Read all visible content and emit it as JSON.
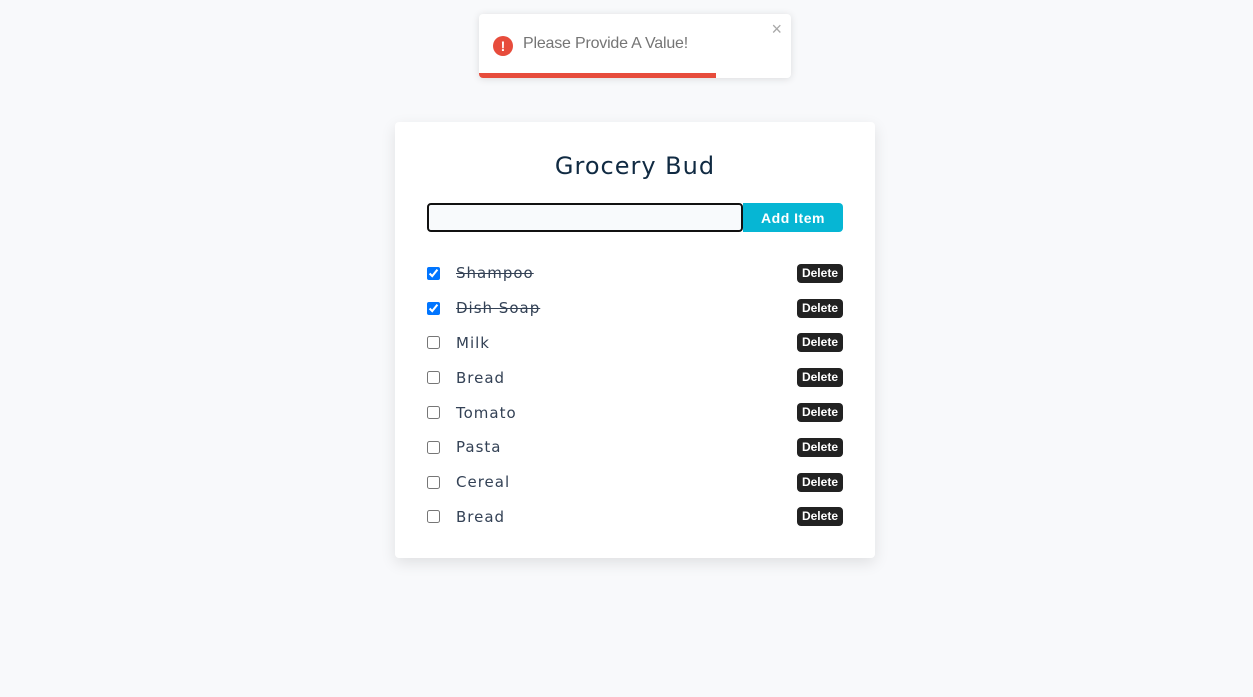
{
  "toast": {
    "icon": "error-icon",
    "icon_glyph": "!",
    "message": "Please Provide A Value!",
    "close_glyph": "×",
    "progress_percent": 76,
    "color": "#e74c3c"
  },
  "app": {
    "title": "Grocery Bud",
    "input_value": "",
    "input_placeholder": "",
    "add_button_label": "Add Item",
    "accent_color": "#06b6d4"
  },
  "items": [
    {
      "name": "Shampoo",
      "completed": true,
      "delete_label": "Delete"
    },
    {
      "name": "Dish Soap",
      "completed": true,
      "delete_label": "Delete"
    },
    {
      "name": "Milk",
      "completed": false,
      "delete_label": "Delete"
    },
    {
      "name": "Bread",
      "completed": false,
      "delete_label": "Delete"
    },
    {
      "name": "Tomato",
      "completed": false,
      "delete_label": "Delete"
    },
    {
      "name": "Pasta",
      "completed": false,
      "delete_label": "Delete"
    },
    {
      "name": "Cereal",
      "completed": false,
      "delete_label": "Delete"
    },
    {
      "name": "Bread",
      "completed": false,
      "delete_label": "Delete"
    }
  ]
}
